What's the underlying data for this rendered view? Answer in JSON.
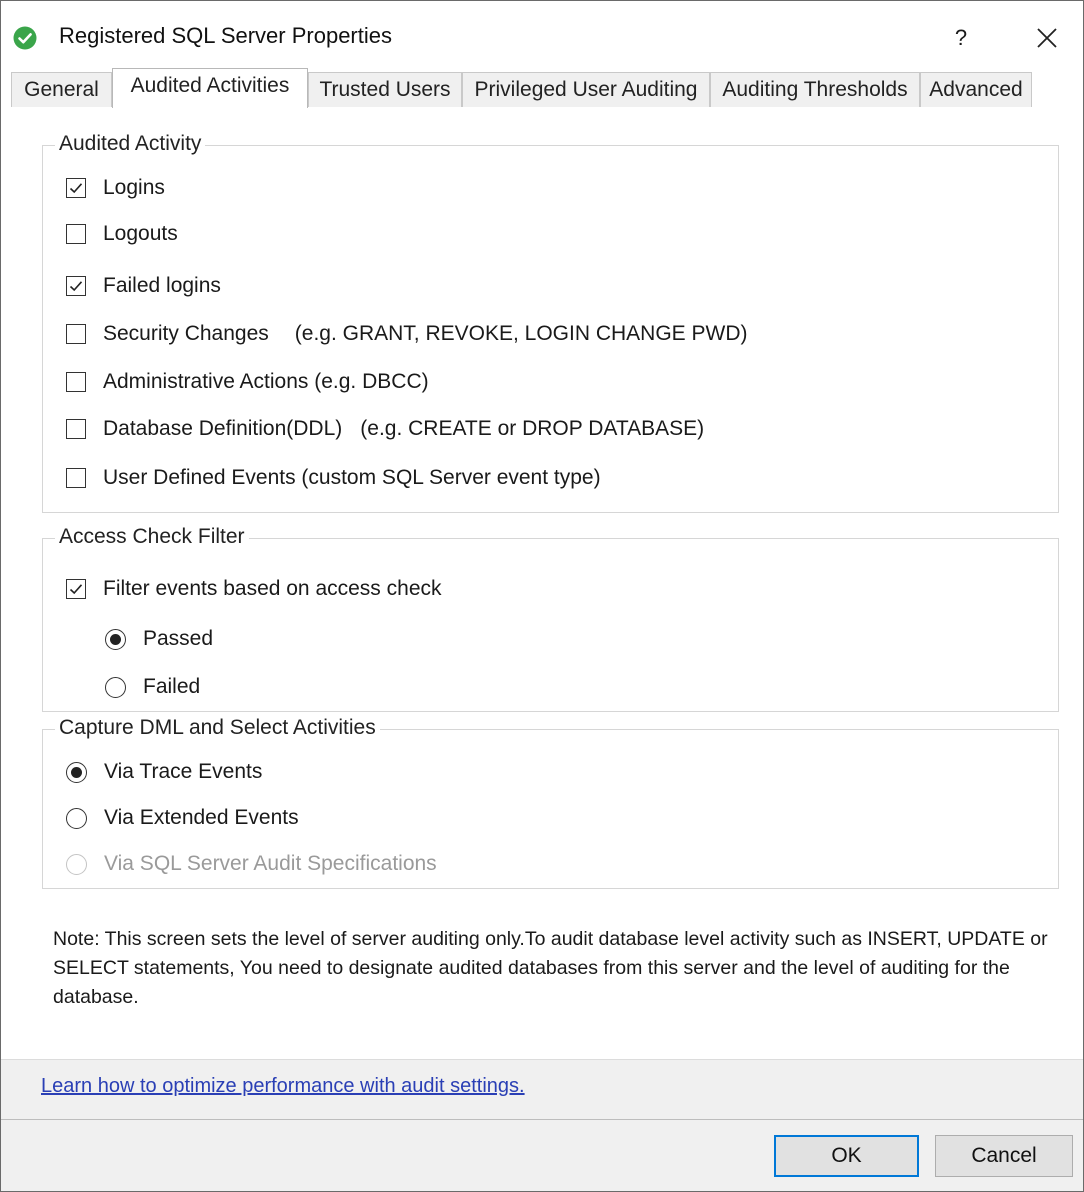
{
  "window": {
    "title": "Registered SQL Server Properties",
    "help_label": "?",
    "icon": "check-circle-icon",
    "accent_color": "#0078d7",
    "icon_color": "#3aa54a"
  },
  "tabs": [
    {
      "label": "General",
      "active": false
    },
    {
      "label": "Audited Activities",
      "active": true
    },
    {
      "label": "Trusted Users",
      "active": false
    },
    {
      "label": "Privileged User Auditing",
      "active": false
    },
    {
      "label": "Auditing Thresholds",
      "active": false
    },
    {
      "label": "Advanced",
      "active": false
    }
  ],
  "audited_activity": {
    "title": "Audited Activity",
    "items": [
      {
        "label": "Logins",
        "checked": true
      },
      {
        "label": "Logouts",
        "checked": false
      },
      {
        "label": "Failed logins",
        "checked": true
      },
      {
        "label": "Security Changes",
        "hint": "(e.g.  GRANT, REVOKE, LOGIN CHANGE PWD)",
        "checked": false
      },
      {
        "label": "Administrative Actions (e.g. DBCC)",
        "checked": false
      },
      {
        "label": "Database Definition(DDL)",
        "hint": "(e.g.  CREATE or DROP DATABASE)",
        "checked": false
      },
      {
        "label": "User Defined Events (custom SQL Server event type)",
        "checked": false
      }
    ]
  },
  "access_check": {
    "title": "Access Check Filter",
    "filter_label": "Filter events based on access check",
    "filter_checked": true,
    "passed_label": "Passed",
    "failed_label": "Failed",
    "selected": "Passed"
  },
  "capture_dml": {
    "title": "Capture DML and Select Activities",
    "trace_label": "Via Trace Events",
    "extended_label": "Via Extended Events",
    "audit_spec_label": "Via SQL Server Audit Specifications",
    "selected": "Via Trace Events",
    "audit_spec_disabled": true
  },
  "note": "Note: This screen sets the level of server auditing only.To audit database level activity such as INSERT, UPDATE or SELECT statements, You need to designate audited databases from this server and the level of auditing for the database.",
  "link_text": "Learn how to optimize performance with audit settings.",
  "buttons": {
    "ok": "OK",
    "cancel": "Cancel"
  }
}
